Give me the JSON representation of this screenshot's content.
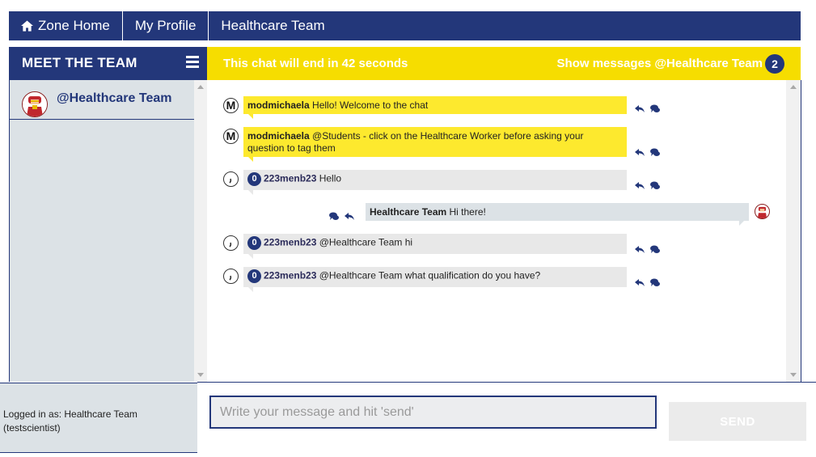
{
  "nav": {
    "home_label": "Zone Home",
    "profile_label": "My Profile",
    "team_label": "Healthcare Team"
  },
  "left": {
    "title": "MEET THE TEAM",
    "team_name": "@Healthcare Team"
  },
  "chat_header": {
    "timer_text": "This chat will end in 42 seconds",
    "show_messages": "Show messages @Healthcare Team",
    "badge_count": "2"
  },
  "messages": [
    {
      "sender": "modmichaela",
      "text": " Hello! Welcome to the chat"
    },
    {
      "sender": "modmichaela",
      "text": " @Students - click on the Healthcare Worker before asking your question to tag them"
    },
    {
      "badge": "0",
      "sender": "223menb23",
      "text": " Hello"
    },
    {
      "sender": "Healthcare Team",
      "text": " Hi there!"
    },
    {
      "badge": "0",
      "sender": "223menb23",
      "text": " @Healthcare Team hi"
    },
    {
      "badge": "0",
      "sender": "223menb23",
      "text": " @Healthcare Team what qualification do you have?"
    }
  ],
  "footer": {
    "logged_in": "Logged in as: Healthcare Team (testscientist)",
    "input_placeholder": "Write your message and hit 'send'",
    "send_label": "SEND"
  },
  "colors": {
    "navy": "#23377a",
    "yellow": "#f6dd00",
    "bubble_yellow": "#fde92e",
    "panel_grey": "#dce2e6"
  }
}
